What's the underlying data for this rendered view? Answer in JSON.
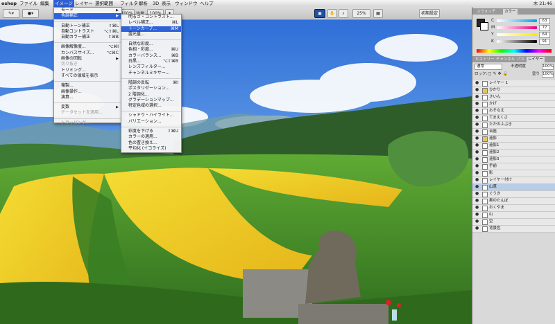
{
  "menubar": {
    "app": "oshop",
    "items": [
      "ファイル",
      "編集",
      "イメージ",
      "レイヤー",
      "選択範囲",
      "フィルタ",
      "解析",
      "3D",
      "表示",
      "ウィンドウ",
      "ヘルプ"
    ],
    "active_index": 2,
    "clock": "木 21:46"
  },
  "options": {
    "zoom_value": "100%",
    "flow_label": "流量",
    "flow_value": "100%",
    "view_zoom": "25%",
    "essentials_button": "初期設定"
  },
  "image_menu": {
    "items": [
      {
        "label": "モード",
        "submenu": true
      },
      {
        "label": "色調補正",
        "submenu": true,
        "highlighted": true
      },
      {
        "sep": true
      },
      {
        "label": "自動トーン補正",
        "shortcut": "⇧⌘L"
      },
      {
        "label": "自動コントラスト",
        "shortcut": "⌥⇧⌘L"
      },
      {
        "label": "自動カラー補正",
        "shortcut": "⇧⌘B"
      },
      {
        "sep": true
      },
      {
        "label": "画像解像度...",
        "shortcut": "⌥⌘I"
      },
      {
        "label": "カンバスサイズ...",
        "shortcut": "⌥⌘C"
      },
      {
        "label": "画像の回転",
        "submenu": true
      },
      {
        "label": "切り抜き",
        "disabled": true
      },
      {
        "label": "トリミング..."
      },
      {
        "label": "すべての領域を表示"
      },
      {
        "sep": true
      },
      {
        "label": "複製..."
      },
      {
        "label": "画像操作..."
      },
      {
        "label": "演算..."
      },
      {
        "sep": true
      },
      {
        "label": "変数",
        "submenu": true
      },
      {
        "label": "データセットを適用...",
        "disabled": true
      },
      {
        "sep": true
      },
      {
        "label": "トラッピング...",
        "disabled": true
      }
    ]
  },
  "adjust_menu": {
    "items": [
      {
        "label": "明るさ・コントラスト..."
      },
      {
        "label": "レベル補正...",
        "shortcut": "⌘L"
      },
      {
        "label": "トーンカーブ...",
        "shortcut": "⌘M",
        "highlighted": true
      },
      {
        "label": "露光量..."
      },
      {
        "sep": true
      },
      {
        "label": "自然な彩度..."
      },
      {
        "label": "色相・彩度...",
        "shortcut": "⌘U"
      },
      {
        "label": "カラーバランス...",
        "shortcut": "⌘B"
      },
      {
        "label": "白黒...",
        "shortcut": "⌥⇧⌘B"
      },
      {
        "label": "レンズフィルター..."
      },
      {
        "label": "チャンネルミキサー..."
      },
      {
        "sep": true
      },
      {
        "label": "階調の反転",
        "shortcut": "⌘I"
      },
      {
        "label": "ポスタリゼーション..."
      },
      {
        "label": "2 階調化..."
      },
      {
        "label": "グラデーションマップ..."
      },
      {
        "label": "特定色域の選択..."
      },
      {
        "sep": true
      },
      {
        "label": "シャドウ・ハイライト..."
      },
      {
        "label": "バリエーション..."
      },
      {
        "sep": true
      },
      {
        "label": "彩度を下げる",
        "shortcut": "⇧⌘U"
      },
      {
        "label": "カラーの適用..."
      },
      {
        "label": "色の置き換え..."
      },
      {
        "label": "平均化 (イコライズ)"
      }
    ]
  },
  "color_panel": {
    "tabs": [
      "スウォッチ",
      "カラー"
    ],
    "sliders": [
      {
        "channel": "C",
        "value": "63"
      },
      {
        "channel": "M",
        "value": "77"
      },
      {
        "channel": "Y",
        "value": "64"
      },
      {
        "channel": "K",
        "value": "91"
      }
    ],
    "unit": "%"
  },
  "layers_panel": {
    "tabs": [
      "ヒストリー",
      "チャンネル",
      "パス",
      "レイヤー"
    ],
    "blend_mode": "通常",
    "opacity_label": "不透明度",
    "opacity_value": "100%",
    "lock_label": "ロック:",
    "fill_label": "塗り",
    "fill_value": "100%",
    "layers": [
      {
        "name": "レイヤー 1"
      },
      {
        "name": "ひかり",
        "group": true
      },
      {
        "name": "さいん"
      },
      {
        "name": "かげ"
      },
      {
        "name": "おそなえ"
      },
      {
        "name": "てまえくさ"
      },
      {
        "name": "たかのふぶき"
      },
      {
        "name": "台座"
      },
      {
        "name": "遠影",
        "group": true
      },
      {
        "name": "遠影1"
      },
      {
        "name": "遠影2"
      },
      {
        "name": "遠影3"
      },
      {
        "name": "手前"
      },
      {
        "name": "影"
      },
      {
        "name": "レイヤー付け"
      },
      {
        "name": "山草",
        "selected": true
      },
      {
        "name": "ぐうき"
      },
      {
        "name": "奥のたんぼ"
      },
      {
        "name": "おくやま"
      },
      {
        "name": "山"
      },
      {
        "name": "空"
      },
      {
        "name": "背景色"
      }
    ]
  },
  "colors": {
    "menu_highlight": "#2f62d8",
    "layer_selected": "#b7cde8",
    "sky_top": "#2f6fd8",
    "field_yellow": "#f0d21e",
    "field_green": "#4f9a2c"
  }
}
